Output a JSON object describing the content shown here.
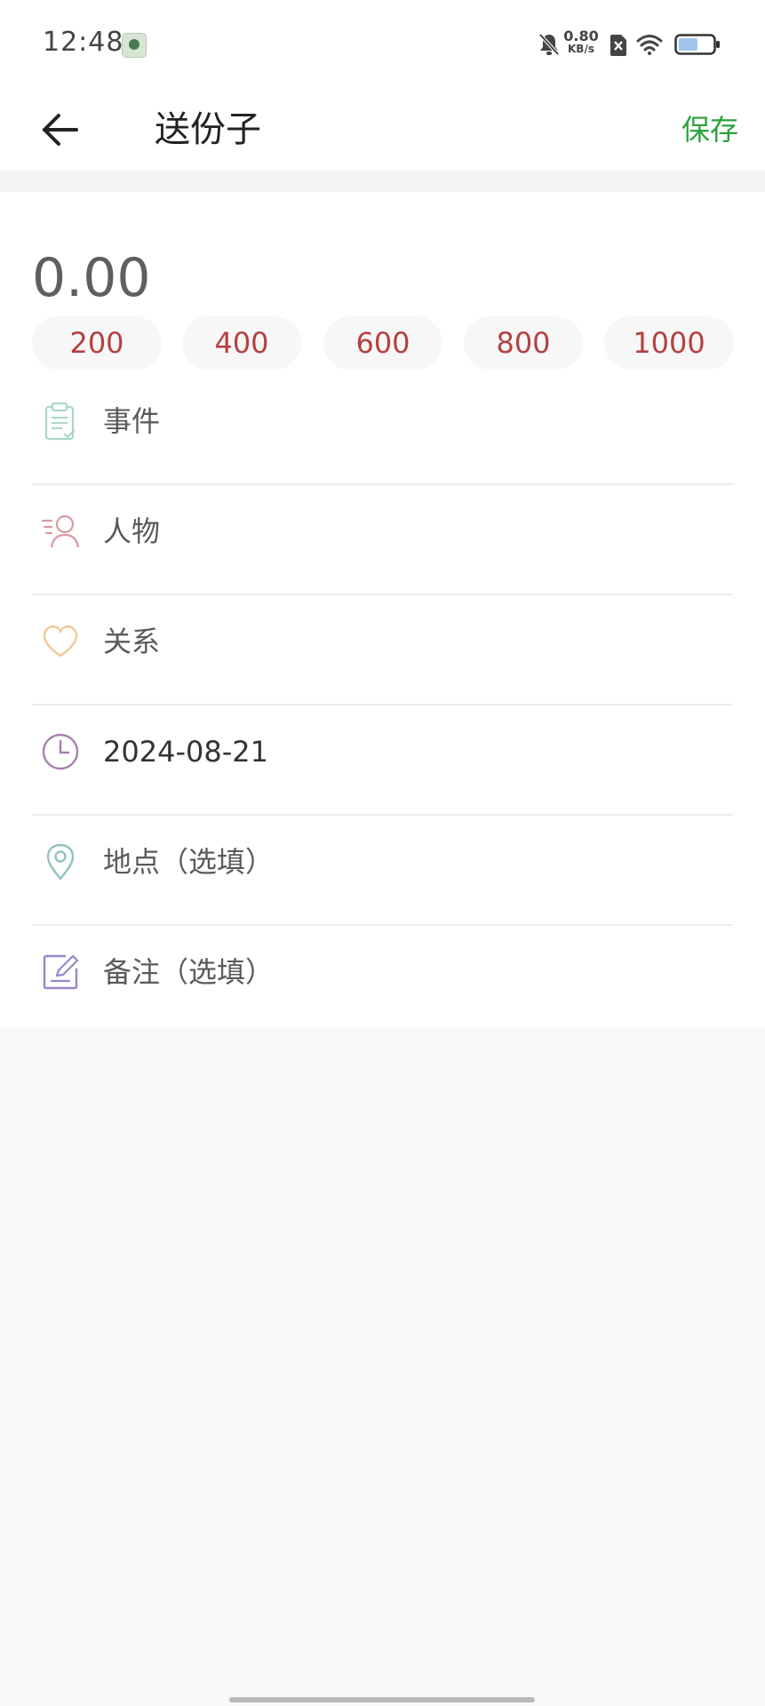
{
  "status_bar": {
    "time": "12:48",
    "net_speed_value": "0.80",
    "net_speed_unit": "KB/s",
    "icons": [
      "gallery-notification-icon",
      "bell-muted-icon",
      "sim-x-icon",
      "wifi-icon",
      "battery-icon"
    ],
    "battery_level": 0.55
  },
  "app_bar": {
    "title": "送份子",
    "save_label": "保存",
    "accent_color": "#2aa33a"
  },
  "amount": {
    "value": "0.00",
    "chips": [
      "200",
      "400",
      "600",
      "800",
      "1000"
    ],
    "chip_text_color": "#b44141"
  },
  "form": {
    "event": {
      "label": "事件",
      "icon": "clipboard-icon"
    },
    "person": {
      "label": "人物",
      "icon": "person-icon"
    },
    "relation": {
      "label": "关系",
      "icon": "heart-icon"
    },
    "date": {
      "value": "2024-08-21",
      "icon": "clock-icon"
    },
    "location": {
      "placeholder": "地点（选填）",
      "icon": "location-pin-icon"
    },
    "note": {
      "placeholder": "备注（选填）",
      "icon": "edit-note-icon"
    }
  }
}
